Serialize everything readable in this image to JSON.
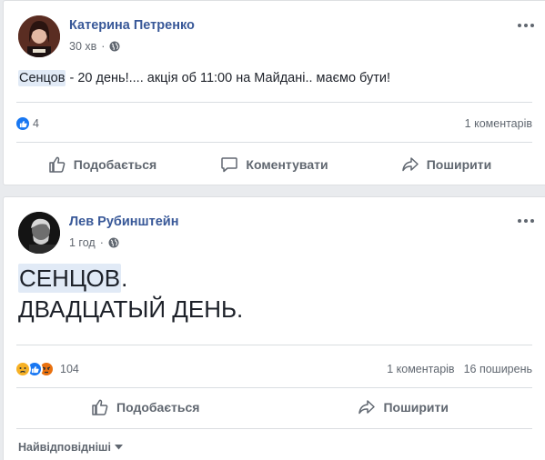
{
  "post1": {
    "author": "Катерина Петренко",
    "time": "30 хв",
    "privacy_icon": "globe-icon",
    "text_highlight": "Сенцов",
    "text_rest": " - 20 день!.... акція об 11:00 на Майдані.. маємо бути!",
    "like_count": "4",
    "comments": "1 коментарів",
    "actions": {
      "like": "Подобається",
      "comment": "Коментувати",
      "share": "Поширити"
    }
  },
  "post2": {
    "author": "Лев Рубинштейн",
    "time": "1 год",
    "privacy_icon": "globe-icon",
    "text_line1_highlight": "СЕНЦОВ",
    "text_line1_rest": ".",
    "text_line2": "ДВАДЦАТЫЙ ДЕНЬ.",
    "reaction_count": "104",
    "comments": "1 коментарів",
    "shares": "16 поширень",
    "actions": {
      "like": "Подобається",
      "share": "Поширити"
    },
    "sort_label": "Найвідповідніші"
  },
  "colors": {
    "link": "#385898",
    "like_blue": "#1877f2",
    "highlight": "#e1eaf6",
    "angry": "#e9710f",
    "sad": "#f7b125"
  }
}
